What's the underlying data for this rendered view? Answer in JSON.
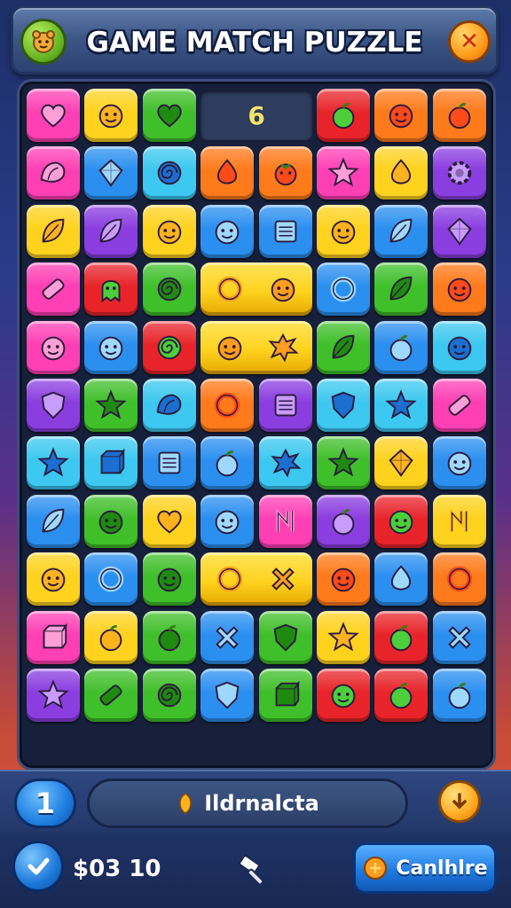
{
  "header": {
    "title": "GAME MATCH PUZZLE",
    "left_icon": "bear-face-icon",
    "close_icon": "close-icon"
  },
  "board": {
    "counter": "6",
    "colors": {
      "pink": "#ff3fb4",
      "orange": "#ff7a1a",
      "yellow": "#ffd21e",
      "green": "#3fbf2a",
      "blue": "#2b8ff0",
      "purple": "#8a3ee0",
      "red": "#e8242a",
      "cyan": "#3cc8f0",
      "lime": "#7bd42a"
    },
    "rows": [
      [
        [
          "pink",
          "heart"
        ],
        [
          "yellow",
          "face"
        ],
        [
          "green",
          "heart"
        ],
        [
          "counter",
          ""
        ],
        [
          "red",
          "apple"
        ],
        [
          "orange",
          "face"
        ],
        [
          "orange",
          "apple"
        ]
      ],
      [
        [
          "pink",
          "shell"
        ],
        [
          "blue",
          "gem"
        ],
        [
          "cyan",
          "spiral"
        ],
        [
          "orange",
          "drop"
        ],
        [
          "orange",
          "berry"
        ],
        [
          "pink",
          "star"
        ],
        [
          "yellow",
          "drop"
        ],
        [
          "purple",
          "gear"
        ]
      ],
      [
        [
          "yellow",
          "leaf"
        ],
        [
          "purple",
          "leaf"
        ],
        [
          "yellow",
          "face"
        ],
        [
          "blue",
          "face"
        ],
        [
          "blue",
          "square"
        ],
        [
          "yellow",
          "face"
        ],
        [
          "blue",
          "leaf"
        ],
        [
          "purple",
          "gem"
        ]
      ],
      [
        [
          "pink",
          "candy"
        ],
        [
          "red",
          "ghost"
        ],
        [
          "green",
          "spiral"
        ],
        [
          "wide-yellow",
          "ring"
        ],
        [
          "wide-yellow",
          "face"
        ],
        [
          "blue",
          "ring"
        ],
        [
          "green",
          "leaf"
        ],
        [
          "orange",
          "face"
        ]
      ],
      [
        [
          "pink",
          "face"
        ],
        [
          "blue",
          "face"
        ],
        [
          "red",
          "spiral"
        ],
        [
          "wide-yellow",
          "face"
        ],
        [
          "wide-yellow",
          "splat"
        ],
        [
          "green",
          "leaf"
        ],
        [
          "blue",
          "apple"
        ],
        [
          "cyan",
          "face"
        ]
      ],
      [
        [
          "purple",
          "shield"
        ],
        [
          "green",
          "star"
        ],
        [
          "cyan",
          "shell"
        ],
        [
          "orange",
          "ring"
        ],
        [
          "purple",
          "square"
        ],
        [
          "cyan",
          "shield"
        ],
        [
          "cyan",
          "star"
        ],
        [
          "pink",
          "candy"
        ]
      ],
      [
        [
          "cyan",
          "star"
        ],
        [
          "cyan",
          "box"
        ],
        [
          "blue",
          "square"
        ],
        [
          "blue",
          "apple"
        ],
        [
          "cyan",
          "splat"
        ],
        [
          "green",
          "star"
        ],
        [
          "yellow",
          "gem"
        ],
        [
          "blue",
          "face"
        ]
      ],
      [
        [
          "blue",
          "leaf"
        ],
        [
          "green",
          "face"
        ],
        [
          "yellow",
          "heart"
        ],
        [
          "blue",
          "face"
        ],
        [
          "pink",
          "rune"
        ],
        [
          "purple",
          "apple"
        ],
        [
          "red",
          "face"
        ],
        [
          "yellow",
          "rune"
        ]
      ],
      [
        [
          "yellow",
          "face"
        ],
        [
          "blue",
          "ring"
        ],
        [
          "green",
          "face"
        ],
        [
          "wide-yellow",
          "ring"
        ],
        [
          "wide-yellow",
          "cross"
        ],
        [
          "orange",
          "face"
        ],
        [
          "blue",
          "drop"
        ],
        [
          "orange",
          "ring"
        ]
      ],
      [
        [
          "pink",
          "box"
        ],
        [
          "yellow",
          "apple"
        ],
        [
          "green",
          "apple"
        ],
        [
          "blue",
          "cross"
        ],
        [
          "green",
          "shield"
        ],
        [
          "yellow",
          "star"
        ],
        [
          "red",
          "apple"
        ],
        [
          "blue",
          "cross"
        ]
      ],
      [
        [
          "purple",
          "star"
        ],
        [
          "green",
          "candy"
        ],
        [
          "green",
          "spiral"
        ],
        [
          "blue",
          "shield"
        ],
        [
          "green",
          "box"
        ],
        [
          "red",
          "face"
        ],
        [
          "red",
          "apple"
        ],
        [
          "blue",
          "apple"
        ]
      ]
    ]
  },
  "bottom": {
    "level": "1",
    "message": "Ildrnalcta",
    "message_icon": "leaf-icon",
    "down_icon": "arrow-down-icon"
  },
  "footer": {
    "score": "$03 10",
    "continue_label": "Canlhlre",
    "check_icon": "check-icon",
    "tool_icon": "hammer-icon",
    "continue_icon": "coin-icon"
  }
}
